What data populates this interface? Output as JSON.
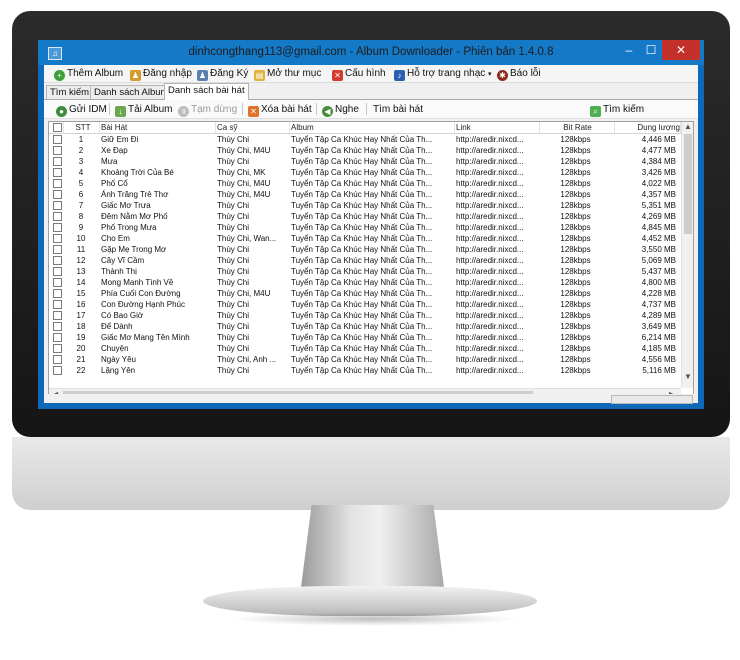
{
  "window": {
    "title": "dinhcongthang113@gmail.com - Album Downloader - Phiên bản 1.4.0.8"
  },
  "menu": {
    "items": [
      {
        "label": "Thêm Album",
        "icon": "plus-circle-icon"
      },
      {
        "label": "Đăng nhập",
        "icon": "user-login-icon"
      },
      {
        "label": "Đăng Ký",
        "icon": "user-register-icon"
      },
      {
        "label": "Mở thư mục",
        "icon": "folder-open-icon"
      },
      {
        "label": "Cấu hình",
        "icon": "tools-icon"
      },
      {
        "label": "Hỗ trợ trang nhạc",
        "icon": "music-note-icon"
      },
      {
        "label": "Báo lỗi",
        "icon": "bug-icon"
      }
    ]
  },
  "tabs": [
    {
      "label": "Tìm kiếm"
    },
    {
      "label": "Danh sách Album"
    },
    {
      "label": "Danh sách bài hát"
    }
  ],
  "toolbar": {
    "items": [
      {
        "label": "Gửi IDM",
        "icon": "idm-icon"
      },
      {
        "label": "Tải Album",
        "icon": "download-icon"
      },
      {
        "label": "Tạm dừng",
        "icon": "pause-icon"
      },
      {
        "label": "Xóa bài hát",
        "icon": "delete-icon"
      },
      {
        "label": "Nghe",
        "icon": "listen-icon"
      },
      {
        "label": "Tìm bài hát",
        "icon": ""
      }
    ],
    "search_label": "Tìm kiếm"
  },
  "table": {
    "columns": [
      "STT",
      "Bài Hát",
      "Ca sỹ",
      "Album",
      "Link",
      "Bit Rate",
      "Dung lượng"
    ],
    "rows": [
      [
        "1",
        "Giữ Em Đi",
        "Thùy Chi",
        "Tuyển Tập Ca Khúc Hay Nhất Của Th...",
        "http://aredir.nixcd...",
        "128kbps",
        "4,446 MB"
      ],
      [
        "2",
        "Xe Đạp",
        "Thùy Chi, M4U",
        "Tuyển Tập Ca Khúc Hay Nhất Của Th...",
        "http://aredir.nixcd...",
        "128kbps",
        "4,477 MB"
      ],
      [
        "3",
        "Mưa",
        "Thùy Chi",
        "Tuyển Tập Ca Khúc Hay Nhất Của Th...",
        "http://aredir.nixcd...",
        "128kbps",
        "4,384 MB"
      ],
      [
        "4",
        "Khoảng Trời Của Bé",
        "Thùy Chi, MK",
        "Tuyển Tập Ca Khúc Hay Nhất Của Th...",
        "http://aredir.nixcd...",
        "128kbps",
        "3,426 MB"
      ],
      [
        "5",
        "Phố Cổ",
        "Thùy Chi, M4U",
        "Tuyển Tập Ca Khúc Hay Nhất Của Th...",
        "http://aredir.nixcd...",
        "128kbps",
        "4,022 MB"
      ],
      [
        "6",
        "Ánh Trăng Trẻ Thơ",
        "Thùy Chi, M4U",
        "Tuyển Tập Ca Khúc Hay Nhất Của Th...",
        "http://aredir.nixcd...",
        "128kbps",
        "4,357 MB"
      ],
      [
        "7",
        "Giấc Mơ Trưa",
        "Thùy Chi",
        "Tuyển Tập Ca Khúc Hay Nhất Của Th...",
        "http://aredir.nixcd...",
        "128kbps",
        "5,351 MB"
      ],
      [
        "8",
        "Đêm Nằm Mơ Phố",
        "Thùy Chi",
        "Tuyển Tập Ca Khúc Hay Nhất Của Th...",
        "http://aredir.nixcd...",
        "128kbps",
        "4,269 MB"
      ],
      [
        "9",
        "Phố Trong Mưa",
        "Thùy Chi",
        "Tuyển Tập Ca Khúc Hay Nhất Của Th...",
        "http://aredir.nixcd...",
        "128kbps",
        "4,845 MB"
      ],
      [
        "10",
        "Cho Em",
        "Thùy Chi, Wan...",
        "Tuyển Tập Ca Khúc Hay Nhất Của Th...",
        "http://aredir.nixcd...",
        "128kbps",
        "4,452 MB"
      ],
      [
        "11",
        "Gặp Mẹ Trong Mơ",
        "Thùy Chi",
        "Tuyển Tập Ca Khúc Hay Nhất Của Th...",
        "http://aredir.nixcd...",
        "128kbps",
        "3,550 MB"
      ],
      [
        "12",
        "Cây Vĩ Cầm",
        "Thùy Chi",
        "Tuyển Tập Ca Khúc Hay Nhất Của Th...",
        "http://aredir.nixcd...",
        "128kbps",
        "5,069 MB"
      ],
      [
        "13",
        "Thành Thị",
        "Thùy Chi",
        "Tuyển Tập Ca Khúc Hay Nhất Của Th...",
        "http://aredir.nixcd...",
        "128kbps",
        "5,437 MB"
      ],
      [
        "14",
        "Mong Manh Tình Về",
        "Thùy Chi",
        "Tuyển Tập Ca Khúc Hay Nhất Của Th...",
        "http://aredir.nixcd...",
        "128kbps",
        "4,800 MB"
      ],
      [
        "15",
        "Phía Cuối Con Đường",
        "Thùy Chi, M4U",
        "Tuyển Tập Ca Khúc Hay Nhất Của Th...",
        "http://aredir.nixcd...",
        "128kbps",
        "4,228 MB"
      ],
      [
        "16",
        "Con Đường Hạnh Phúc",
        "Thùy Chi",
        "Tuyển Tập Ca Khúc Hay Nhất Của Th...",
        "http://aredir.nixcd...",
        "128kbps",
        "4,737 MB"
      ],
      [
        "17",
        "Có Bao Giờ",
        "Thùy Chi",
        "Tuyển Tập Ca Khúc Hay Nhất Của Th...",
        "http://aredir.nixcd...",
        "128kbps",
        "4,289 MB"
      ],
      [
        "18",
        "Để Dành",
        "Thùy Chi",
        "Tuyển Tập Ca Khúc Hay Nhất Của Th...",
        "http://aredir.nixcd...",
        "128kbps",
        "3,649 MB"
      ],
      [
        "19",
        "Giấc Mơ Mang Tên Mình",
        "Thùy Chi",
        "Tuyển Tập Ca Khúc Hay Nhất Của Th...",
        "http://aredir.nixcd...",
        "128kbps",
        "6,214 MB"
      ],
      [
        "20",
        "Chuyện",
        "Thùy Chi",
        "Tuyển Tập Ca Khúc Hay Nhất Của Th...",
        "http://aredir.nixcd...",
        "128kbps",
        "4,185 MB"
      ],
      [
        "21",
        "Ngày Yêu",
        "Thùy Chi, Anh ...",
        "Tuyển Tập Ca Khúc Hay Nhất Của Th...",
        "http://aredir.nixcd...",
        "128kbps",
        "4,556 MB"
      ],
      [
        "22",
        "Lặng Yên",
        "Thùy Chi",
        "Tuyển Tập Ca Khúc Hay Nhất Của Th...",
        "http://aredir.nixcd...",
        "128kbps",
        "5,116 MB"
      ]
    ]
  }
}
